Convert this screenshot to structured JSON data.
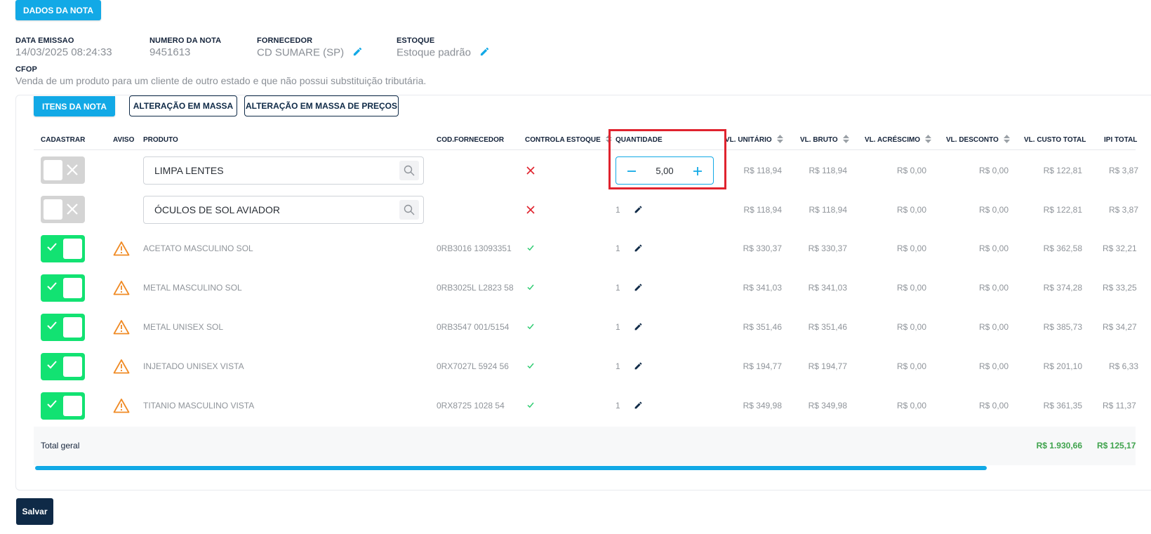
{
  "top_tab": {
    "label": "DADOS DA NOTA"
  },
  "header_fields": {
    "data_emissao": {
      "label": "DATA EMISSAO",
      "value": "14/03/2025 08:24:33"
    },
    "numero_nota": {
      "label": "NUMERO DA NOTA",
      "value": "9451613"
    },
    "fornecedor": {
      "label": "FORNECEDOR",
      "value": "CD SUMARE (SP)"
    },
    "estoque": {
      "label": "ESTOQUE",
      "value": "Estoque padrão"
    },
    "cfop": {
      "label": "CFOP",
      "value": "Venda de um produto para um cliente de outro estado e que não possui substituição tributária."
    }
  },
  "tabs": {
    "itens": "ITENS DA NOTA",
    "alteracao_massa": "ALTERAÇÃO EM MASSA",
    "alteracao_precos": "ALTERAÇÃO EM MASSA DE PREÇOS"
  },
  "columns": {
    "cadastrar": "CADASTRAR",
    "aviso": "AVISO",
    "produto": "PRODUTO",
    "cod_fornecedor": "COD.FORNECEDOR",
    "controla_estoque": "CONTROLA ESTOQUE",
    "quantidade": "QUANTIDADE",
    "vl_unitario": "VL. UNITÁRIO",
    "vl_bruto": "VL. BRUTO",
    "vl_acrescimo": "VL. ACRÉSCIMO",
    "vl_desconto": "VL. DESCONTO",
    "vl_custo_total": "VL. CUSTO TOTAL",
    "ipi_total": "IPI TOTAL"
  },
  "rows": [
    {
      "cadastrar": false,
      "aviso": false,
      "produto": "LIMPA LENTES",
      "cod": "",
      "controla": false,
      "qtd": "5,00",
      "vl_unitario": "R$ 118,94",
      "vl_bruto": "R$ 118,94",
      "vl_acrescimo": "R$ 0,00",
      "vl_desconto": "R$ 0,00",
      "vl_custo_total": "R$ 122,81",
      "ipi_total": "R$ 3,87"
    },
    {
      "cadastrar": false,
      "aviso": false,
      "produto": "ÓCULOS DE SOL AVIADOR",
      "cod": "",
      "controla": false,
      "qtd": "1",
      "vl_unitario": "R$ 118,94",
      "vl_bruto": "R$ 118,94",
      "vl_acrescimo": "R$ 0,00",
      "vl_desconto": "R$ 0,00",
      "vl_custo_total": "R$ 122,81",
      "ipi_total": "R$ 3,87"
    },
    {
      "cadastrar": true,
      "aviso": true,
      "produto": "ACETATO MASCULINO SOL",
      "cod": "0RB3016 13093351",
      "controla": true,
      "qtd": "1",
      "vl_unitario": "R$ 330,37",
      "vl_bruto": "R$ 330,37",
      "vl_acrescimo": "R$ 0,00",
      "vl_desconto": "R$ 0,00",
      "vl_custo_total": "R$ 362,58",
      "ipi_total": "R$ 32,21"
    },
    {
      "cadastrar": true,
      "aviso": true,
      "produto": "METAL MASCULINO SOL",
      "cod": "0RB3025L L2823 58",
      "controla": true,
      "qtd": "1",
      "vl_unitario": "R$ 341,03",
      "vl_bruto": "R$ 341,03",
      "vl_acrescimo": "R$ 0,00",
      "vl_desconto": "R$ 0,00",
      "vl_custo_total": "R$ 374,28",
      "ipi_total": "R$ 33,25"
    },
    {
      "cadastrar": true,
      "aviso": true,
      "produto": "METAL UNISEX SOL",
      "cod": "0RB3547 001/5154",
      "controla": true,
      "qtd": "1",
      "vl_unitario": "R$ 351,46",
      "vl_bruto": "R$ 351,46",
      "vl_acrescimo": "R$ 0,00",
      "vl_desconto": "R$ 0,00",
      "vl_custo_total": "R$ 385,73",
      "ipi_total": "R$ 34,27"
    },
    {
      "cadastrar": true,
      "aviso": true,
      "produto": "INJETADO UNISEX VISTA",
      "cod": "0RX7027L 5924 56",
      "controla": true,
      "qtd": "1",
      "vl_unitario": "R$ 194,77",
      "vl_bruto": "R$ 194,77",
      "vl_acrescimo": "R$ 0,00",
      "vl_desconto": "R$ 0,00",
      "vl_custo_total": "R$ 201,10",
      "ipi_total": "R$ 6,33"
    },
    {
      "cadastrar": true,
      "aviso": true,
      "produto": "TITANIO MASCULINO VISTA",
      "cod": "0RX8725 1028 54",
      "controla": true,
      "qtd": "1",
      "vl_unitario": "R$ 349,98",
      "vl_bruto": "R$ 349,98",
      "vl_acrescimo": "R$ 0,00",
      "vl_desconto": "R$ 0,00",
      "vl_custo_total": "R$ 361,35",
      "ipi_total": "R$ 11,37"
    }
  ],
  "totals": {
    "label": "Total geral",
    "custo_total": "R$ 1.930,66",
    "ipi_total": "R$ 125,17"
  },
  "save_button": "Salvar",
  "colors": {
    "primary": "#12a9e6",
    "dark": "#0f2a47",
    "success": "#12e272",
    "warning": "#f08a24",
    "error": "#e0232e",
    "total_green": "#3fa34d"
  },
  "icons": {
    "edit": "pencil-icon",
    "search": "search-icon",
    "warning": "warning-triangle-icon",
    "check": "check-icon",
    "close": "x-icon",
    "sort": "sort-arrows-icon",
    "minus": "minus-icon",
    "plus": "plus-icon"
  }
}
